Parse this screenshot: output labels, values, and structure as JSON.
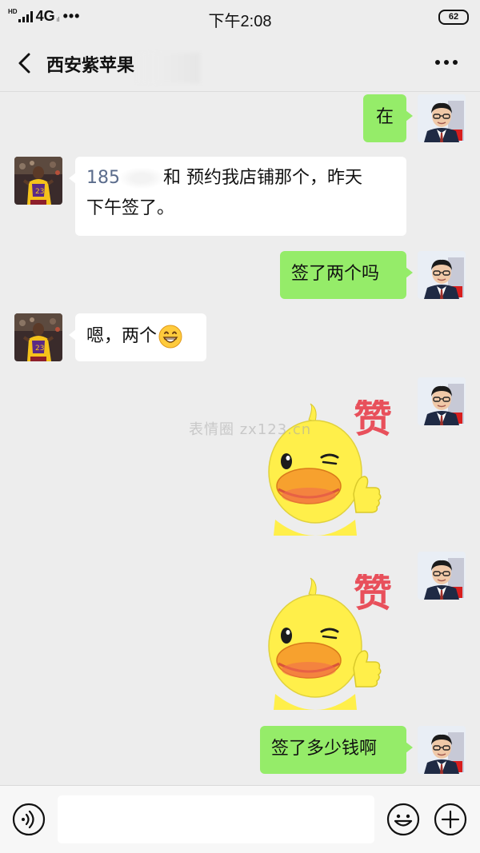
{
  "status_bar": {
    "hd": "HD",
    "network": "4G",
    "lte_mark": "ıl",
    "dots": "•••",
    "time": "下午2:08",
    "battery": "62"
  },
  "header": {
    "title": "西安紫苹果",
    "back_icon": "chevron-left-icon",
    "more_icon": "more-dots-icon"
  },
  "messages": [
    {
      "side": "right",
      "type": "text",
      "text": "在"
    },
    {
      "side": "left",
      "type": "text",
      "phone_prefix": "185",
      "line1_rest": "和 预约我店铺那个，昨天",
      "line2": "下午签了。"
    },
    {
      "side": "right",
      "type": "text",
      "text": "签了两个吗"
    },
    {
      "side": "left",
      "type": "text",
      "text": "嗯，两个",
      "emoji": "grinning-face"
    },
    {
      "side": "right",
      "type": "sticker",
      "sticker_text": "赞",
      "sticker": "yellow-duck-thumbs-up"
    },
    {
      "side": "right",
      "type": "sticker",
      "sticker_text": "赞",
      "sticker": "yellow-duck-thumbs-up"
    },
    {
      "side": "right",
      "type": "text",
      "text": "签了多少钱啊"
    }
  ],
  "watermark": "表情圈 zx123.cn",
  "toolbar": {
    "voice_icon": "voice-icon",
    "input_value": "",
    "emoji_icon": "emoji-icon",
    "plus_icon": "plus-icon"
  },
  "colors": {
    "background": "#ededed",
    "sent_bubble": "#95ec69",
    "received_bubble": "#ffffff",
    "sticker_red": "#e8505b",
    "duck_yellow": "#ffef4a",
    "duck_beak": "#f7a12e"
  }
}
